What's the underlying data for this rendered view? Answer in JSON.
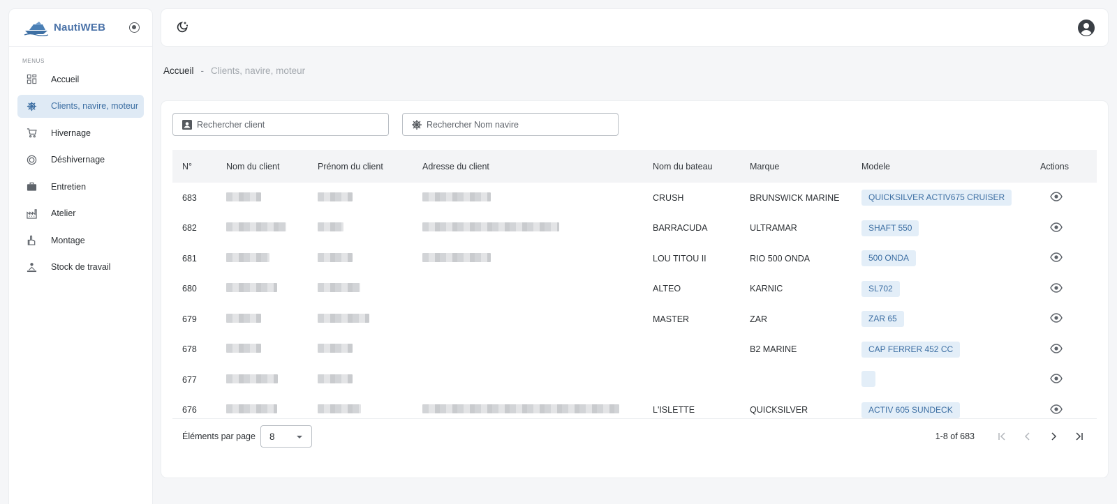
{
  "brand": {
    "name": "NautiWEB"
  },
  "sidebar": {
    "heading": "MENUS",
    "items": [
      {
        "label": "Accueil",
        "icon": "dashboard-icon",
        "active": false
      },
      {
        "label": "Clients, navire, moteur",
        "icon": "ship-wheel-icon",
        "active": true
      },
      {
        "label": "Hivernage",
        "icon": "cart-icon",
        "active": false
      },
      {
        "label": "Déshivernage",
        "icon": "target-icon",
        "active": false
      },
      {
        "label": "Entretien",
        "icon": "briefcase-icon",
        "active": false
      },
      {
        "label": "Atelier",
        "icon": "factory-icon",
        "active": false
      },
      {
        "label": "Montage",
        "icon": "hand-icon",
        "active": false
      },
      {
        "label": "Stock de travail",
        "icon": "worker-icon",
        "active": false
      }
    ]
  },
  "breadcrumb": {
    "home": "Accueil",
    "separator": "-",
    "current": "Clients, navire, moteur"
  },
  "search": {
    "client_placeholder": "Rechercher client",
    "ship_placeholder": "Rechercher Nom navire"
  },
  "table": {
    "columns": [
      "N°",
      "Nom du client",
      "Prénom du client",
      "Adresse du client",
      "Nom du bateau",
      "Marque",
      "Modele",
      "Actions"
    ],
    "rows": [
      {
        "num": "683",
        "bateau": "CRUSH",
        "marque": "BRUNSWICK MARINE",
        "modele": "QUICKSILVER ACTIV675 CRUISER",
        "blur": [
          50,
          50,
          98
        ]
      },
      {
        "num": "682",
        "bateau": "BARRACUDA",
        "marque": "ULTRAMAR",
        "modele": "SHAFT 550",
        "blur": [
          86,
          37,
          196
        ]
      },
      {
        "num": "681",
        "bateau": "LOU TITOU II",
        "marque": "RIO 500 ONDA",
        "modele": "500 ONDA",
        "blur": [
          62,
          50,
          98
        ]
      },
      {
        "num": "680",
        "bateau": "ALTEO",
        "marque": "KARNIC",
        "modele": "SL702",
        "blur": [
          73,
          61,
          0
        ]
      },
      {
        "num": "679",
        "bateau": "MASTER",
        "marque": "ZAR",
        "modele": "ZAR 65",
        "blur": [
          50,
          74,
          0
        ]
      },
      {
        "num": "678",
        "bateau": "",
        "marque": "B2 MARINE",
        "modele": "CAP FERRER 452 CC",
        "blur": [
          50,
          50,
          0
        ]
      },
      {
        "num": "677",
        "bateau": "",
        "marque": "",
        "modele": "",
        "blur": [
          74,
          50,
          0
        ]
      },
      {
        "num": "676",
        "bateau": "L'ISLETTE",
        "marque": "QUICKSILVER",
        "modele": "ACTIV 605 SUNDECK",
        "blur": [
          73,
          62,
          282
        ]
      }
    ]
  },
  "pagination": {
    "per_page_label": "Éléments par page",
    "per_page_value": "8",
    "range": "1-8 of 683"
  },
  "colors": {
    "accent": "#3d6fa3",
    "badge_bg": "#e3eef8",
    "active_bg": "#dfeaf5"
  }
}
